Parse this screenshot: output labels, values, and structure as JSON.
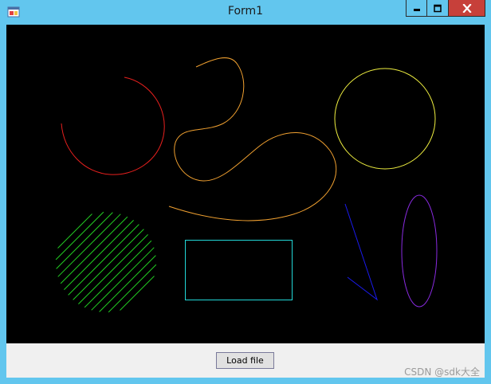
{
  "window": {
    "title": "Form1",
    "controls": {
      "minimize_icon": "minimize-icon",
      "maximize_icon": "maximize-icon",
      "close_icon": "close-icon"
    }
  },
  "canvas": {
    "background": "#000000",
    "shapes": [
      {
        "name": "red-arc",
        "color": "#e8201e"
      },
      {
        "name": "orange-curve",
        "color": "#f0a030"
      },
      {
        "name": "yellow-circle",
        "color": "#f0f040"
      },
      {
        "name": "green-hatched-circle",
        "color": "#22cc22"
      },
      {
        "name": "cyan-rectangle",
        "color": "#22d8d8"
      },
      {
        "name": "blue-lines",
        "color": "#1a1aee"
      },
      {
        "name": "purple-ellipse",
        "color": "#8a2be2"
      }
    ]
  },
  "footer": {
    "load_button_label": "Load file"
  },
  "watermark": "CSDN @sdk大全",
  "colors": {
    "titlebar": "#62c6ee",
    "close_button": "#c7403a",
    "panel": "#f0f0f0"
  }
}
